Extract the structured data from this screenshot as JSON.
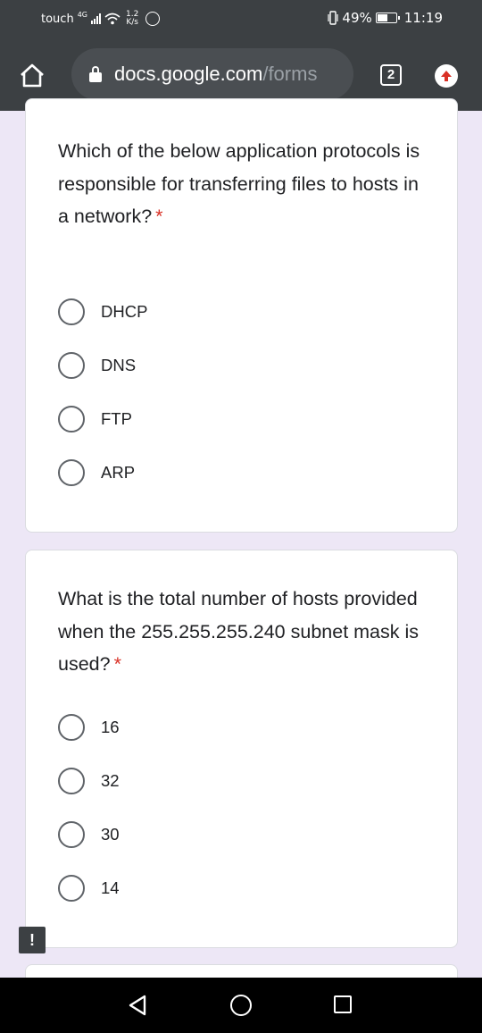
{
  "status_bar": {
    "carrier": "touch",
    "network_type": "4G",
    "speed_value": "1.2",
    "speed_unit": "K/s",
    "battery_percent": "49%",
    "time": "11:19"
  },
  "toolbar": {
    "url_host": "docs.google.com",
    "url_path": "/forms",
    "tab_count": "2"
  },
  "form": {
    "questions": [
      {
        "text": "Which of the below application protocols is responsible for transferring files to hosts in a network?",
        "required_mark": "*",
        "options": [
          "DHCP",
          "DNS",
          "FTP",
          "ARP"
        ]
      },
      {
        "text": "What is the total number of hosts provided when the 255.255.255.240 subnet mask is used?",
        "required_mark": "*",
        "options": [
          "16",
          "32",
          "30",
          "14"
        ]
      }
    ]
  },
  "report_icon_glyph": "!",
  "colors": {
    "chrome_bar": "#3c4043",
    "page_background": "#ede7f6",
    "required": "#d93025",
    "update_arrow": "#d93025"
  }
}
